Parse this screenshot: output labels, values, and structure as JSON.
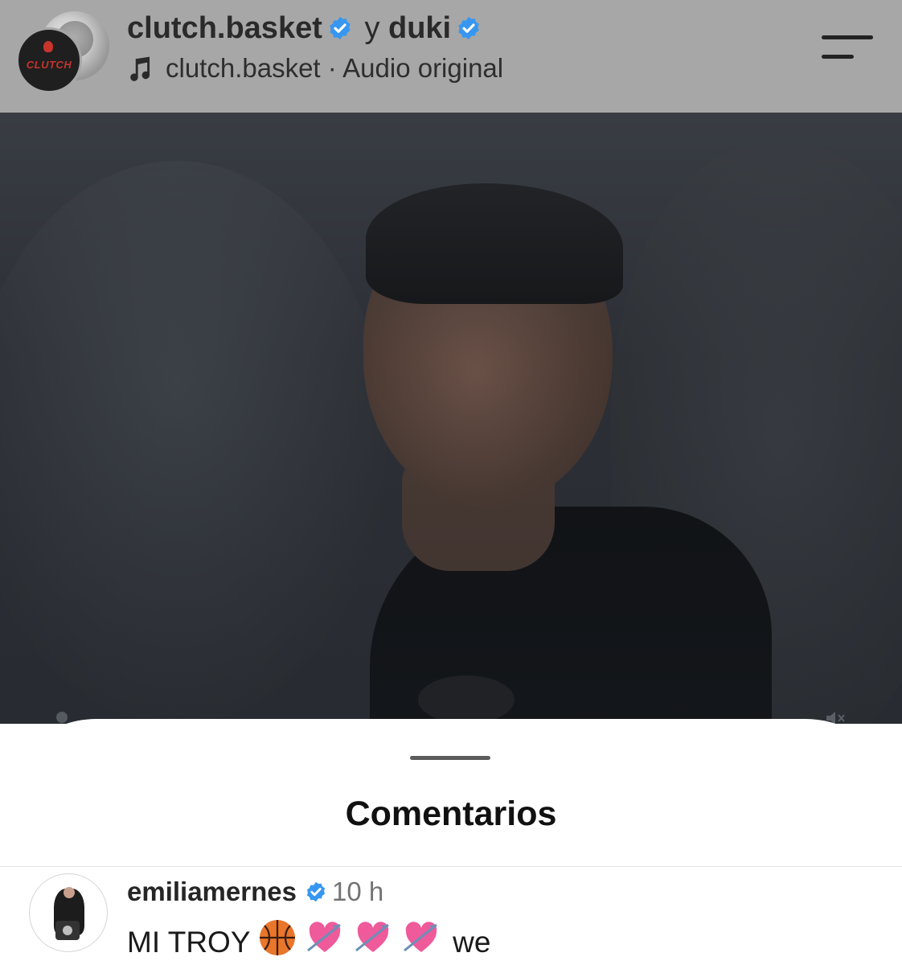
{
  "header": {
    "user1": "clutch.basket",
    "separator": "y",
    "user2": "duki",
    "audio_account": "clutch.basket",
    "audio_dot": "·",
    "audio_label": "Audio original",
    "avatar_logo_text": "CLUTCH",
    "icons": {
      "verified": "verified-badge-icon",
      "music": "music-note-icon",
      "menu": "menu-icon"
    }
  },
  "video": {
    "mute_icon": "muted-speaker-icon"
  },
  "comments": {
    "title": "Comentarios",
    "items": [
      {
        "username": "emiliamernes",
        "time": "10 h",
        "text_prefix": "MI TROY",
        "emojis": [
          "basketball",
          "heart-with-arrow",
          "heart-with-arrow",
          "heart-with-arrow"
        ],
        "text_suffix": "we"
      }
    ]
  },
  "colors": {
    "header_bg": "#a7a7a7",
    "verified": "#3797f0",
    "sheet_bg": "#ffffff"
  }
}
